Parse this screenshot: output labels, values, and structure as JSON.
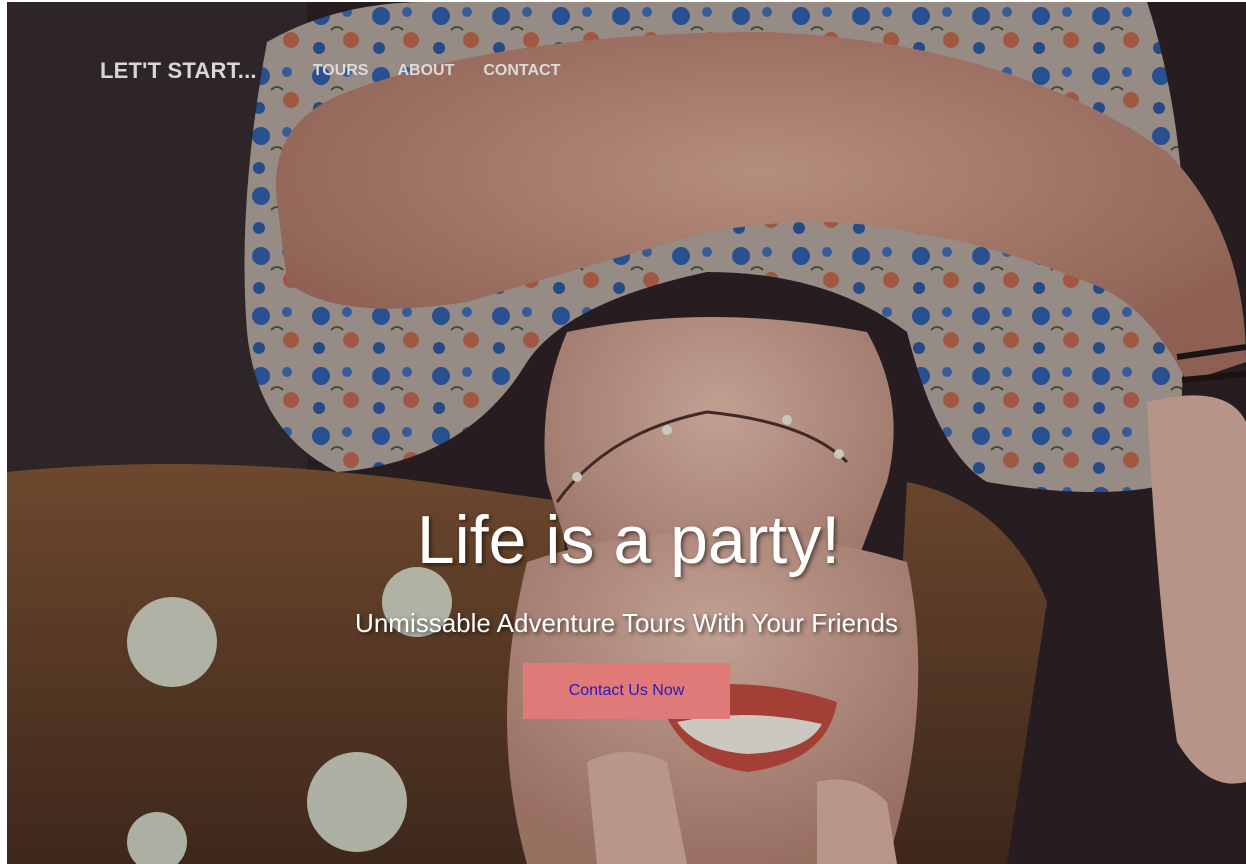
{
  "nav": {
    "brand": "LET'T START...",
    "links": [
      {
        "label": "TOURS"
      },
      {
        "label": "ABOUT"
      },
      {
        "label": "CONTACT"
      }
    ]
  },
  "hero": {
    "title": "Life is a party!",
    "subtitle": "Unmissable Adventure Tours With Your Friends",
    "cta_label": "Contact Us Now",
    "background_image": "hero-photo"
  },
  "colors": {
    "cta_background": "#e07a78",
    "cta_text": "#2a1ab8",
    "nav_text": "#dcdada",
    "hero_text": "#ffffff"
  }
}
